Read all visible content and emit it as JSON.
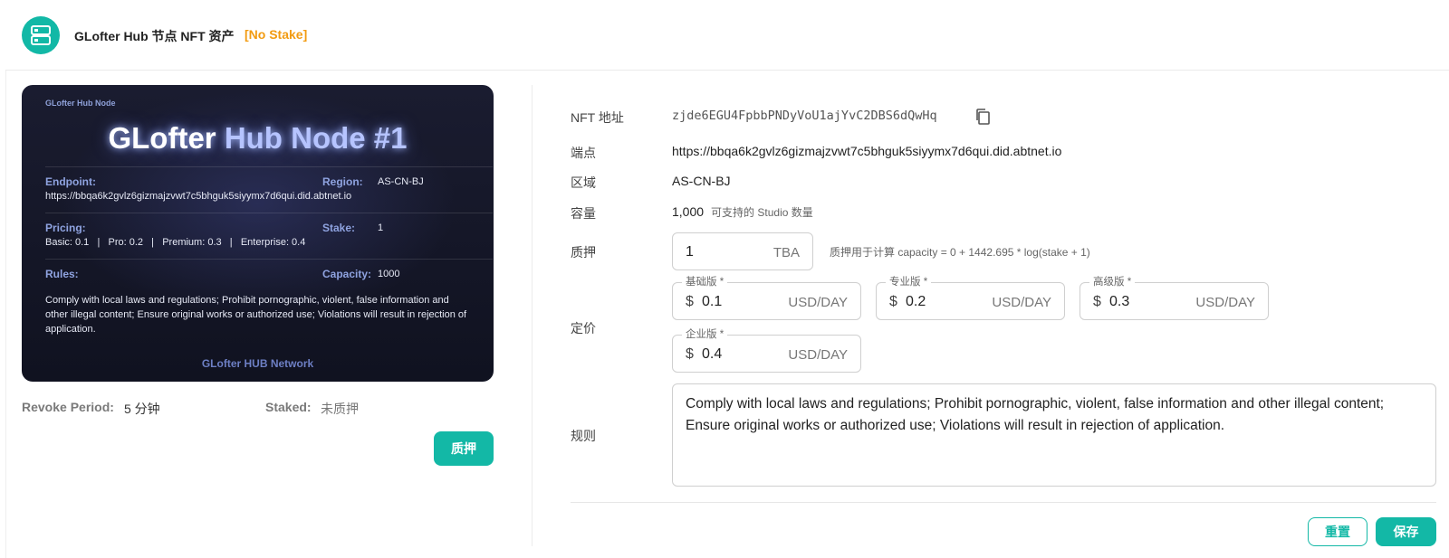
{
  "header": {
    "title": "GLofter Hub 节点 NFT 资产",
    "badge": "[No Stake]"
  },
  "card": {
    "subtitle": "GLofter Hub Node",
    "title_part1": "GLofter ",
    "title_part2": "Hub Node #1",
    "endpoint_label": "Endpoint:",
    "endpoint_value": "https://bbqa6k2gvlz6gizmajzvwt7c5bhguk5siyymx7d6qui.did.abtnet.io",
    "region_label": "Region:",
    "region_value": "AS-CN-BJ",
    "pricing_label": "Pricing:",
    "pricing_value": "Basic: 0.1   |   Pro: 0.2   |   Premium: 0.3   |   Enterprise: 0.4",
    "stake_label": "Stake:",
    "stake_value": "1",
    "rules_label": "Rules:",
    "capacity_label": "Capacity:",
    "capacity_value": "1000",
    "rules_text": "Comply with local laws and regulations; Prohibit pornographic, violent, false information and other illegal content; Ensure original works or authorized use; Violations will result in rejection of application.",
    "footer": "GLofter HUB Network"
  },
  "meta": {
    "revoke_label": "Revoke Period:",
    "revoke_value": "5 分钟",
    "staked_label": "Staked:",
    "staked_value": "未质押"
  },
  "stake_button": "质押",
  "form": {
    "nft_label": "NFT 地址",
    "nft_value": "zjde6EGU4FpbbPNDyVoU1ajYvC2DBS6dQwHq",
    "endpoint_label": "端点",
    "endpoint_value": "https://bbqa6k2gvlz6gizmajzvwt7c5bhguk5siyymx7d6qui.did.abtnet.io",
    "region_label": "区域",
    "region_value": "AS-CN-BJ",
    "capacity_label": "容量",
    "capacity_value": "1,000",
    "capacity_hint": "可支持的 Studio 数量",
    "stake_label": "质押",
    "stake_value": "1",
    "stake_unit": "TBA",
    "stake_hint": "质押用于计算 capacity = 0 + 1442.695 * log(stake + 1)",
    "pricing_label": "定价",
    "prices": [
      {
        "legend": "基础版 *",
        "prefix": "$",
        "value": "0.1",
        "unit": "USD/DAY"
      },
      {
        "legend": "专业版 *",
        "prefix": "$",
        "value": "0.2",
        "unit": "USD/DAY"
      },
      {
        "legend": "高级版 *",
        "prefix": "$",
        "value": "0.3",
        "unit": "USD/DAY"
      },
      {
        "legend": "企业版 *",
        "prefix": "$",
        "value": "0.4",
        "unit": "USD/DAY"
      }
    ],
    "rules_label": "规则",
    "rules_value": "Comply with local laws and regulations; Prohibit pornographic, violent, false information and other illegal content; Ensure original works or authorized use; Violations will result in rejection of application.",
    "reset_button": "重置",
    "save_button": "保存"
  },
  "colors": {
    "accent": "#13b8a6",
    "badge": "#f29b11"
  }
}
